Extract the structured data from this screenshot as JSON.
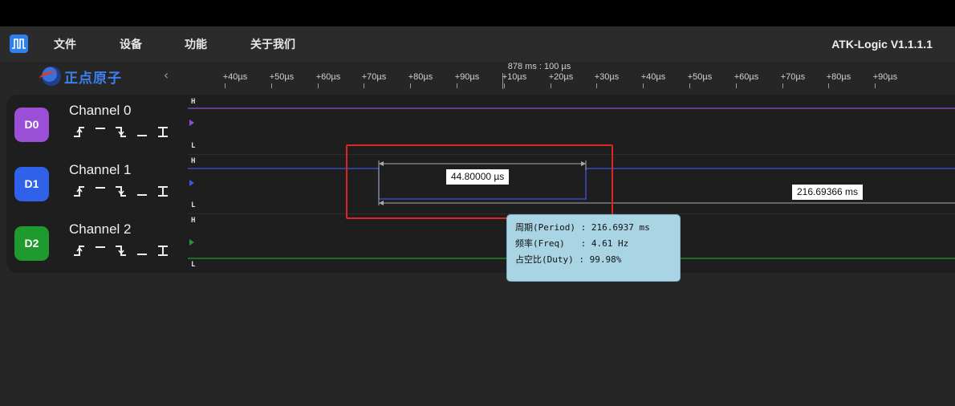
{
  "app": {
    "title": "ATK-Logic  V1.1.1.1",
    "logo_icon": "square-wave-icon",
    "brand_text": "正点原子"
  },
  "menu": {
    "file": "文件",
    "device": "设备",
    "function": "功能",
    "about": "关于我们"
  },
  "ruler": {
    "reference": "878 ms : 100 µs",
    "ticks": [
      "+40µs",
      "+50µs",
      "+60µs",
      "+70µs",
      "+80µs",
      "+90µs",
      "+10µs",
      "+20µs",
      "+30µs",
      "+40µs",
      "+50µs",
      "+60µs",
      "+70µs",
      "+80µs",
      "+90µs"
    ]
  },
  "channels": [
    {
      "badge": "D0",
      "name": "Channel 0",
      "color": "#9b4fd6",
      "high": "H",
      "low": "L"
    },
    {
      "badge": "D1",
      "name": "Channel 1",
      "color": "#2f62e8",
      "high": "H",
      "low": "L"
    },
    {
      "badge": "D2",
      "name": "Channel 2",
      "color": "#1f9a2f",
      "high": "H",
      "low": "L"
    }
  ],
  "trigger_icons": [
    "rising-edge-icon",
    "high-level-icon",
    "falling-edge-icon",
    "low-level-icon",
    "any-edge-icon"
  ],
  "measurements": {
    "pulse_width": "44.80000 µs",
    "period": "216.69366 ms"
  },
  "tooltip": {
    "period": "周期(Period) : 216.6937 ms",
    "freq": "频率(Freq)   : 4.61 Hz",
    "duty": "占空比(Duty) : 99.98%"
  },
  "colors": {
    "highlight": "#e02424",
    "tooltip_bg": "#a9d4e4",
    "logo_blue": "#2f80ed"
  }
}
